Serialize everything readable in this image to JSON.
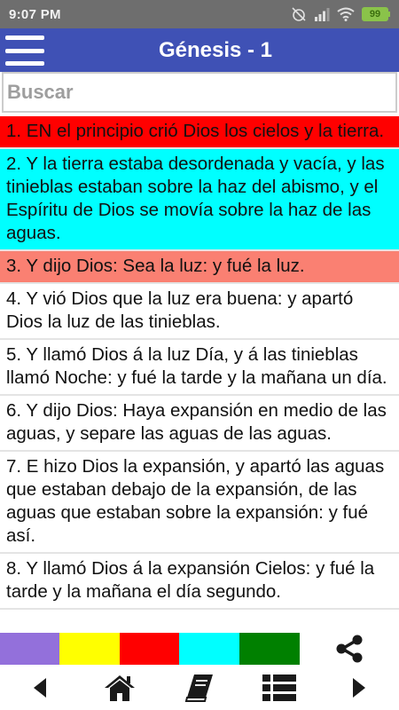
{
  "status_bar": {
    "time": "9:07 PM",
    "battery": "99"
  },
  "app_bar": {
    "title": "Génesis - 1"
  },
  "search": {
    "placeholder": "Buscar",
    "value": ""
  },
  "verses": [
    {
      "text": "1. EN el principio crió Dios los cielos y la tierra.",
      "color": "#ff0000"
    },
    {
      "text": "2. Y la tierra estaba desordenada y vacía, y las tinieblas estaban sobre la haz del abismo, y el Espíritu de Dios se movía sobre la haz de las aguas.",
      "color": "#00ffff"
    },
    {
      "text": "3. Y dijo Dios: Sea la luz: y fué la luz.",
      "color": "#fa8072"
    },
    {
      "text": "4. Y vió Dios que la luz era buena: y apartó Dios la luz de las tinieblas.",
      "color": "#ffffff"
    },
    {
      "text": "5. Y llamó Dios á la luz Día, y á las tinieblas llamó Noche: y fué la tarde y la mañana un día.",
      "color": "#ffffff"
    },
    {
      "text": "6. Y dijo Dios: Haya expansión en medio de las aguas, y separe las aguas de las aguas.",
      "color": "#ffffff"
    },
    {
      "text": "7. E hizo Dios la expansión, y apartó las aguas que estaban debajo de la expansión, de las aguas que estaban sobre la expansión: y fué así.",
      "color": "#ffffff"
    },
    {
      "text": "8. Y llamó Dios á la expansión Cielos: y fué la tarde y la mañana el día segundo.",
      "color": "#ffffff"
    }
  ],
  "palette": [
    {
      "name": "purple",
      "color": "#9370db"
    },
    {
      "name": "yellow",
      "color": "#ffff00"
    },
    {
      "name": "red",
      "color": "#ff0000"
    },
    {
      "name": "cyan",
      "color": "#00ffff"
    },
    {
      "name": "green",
      "color": "#008000"
    }
  ],
  "icons": {
    "menu": "hamburger-menu-icon",
    "share": "share-icon",
    "previous": "chevron-left-icon",
    "home": "home-icon",
    "book": "book-icon",
    "list": "list-icon",
    "next": "chevron-right-icon"
  }
}
